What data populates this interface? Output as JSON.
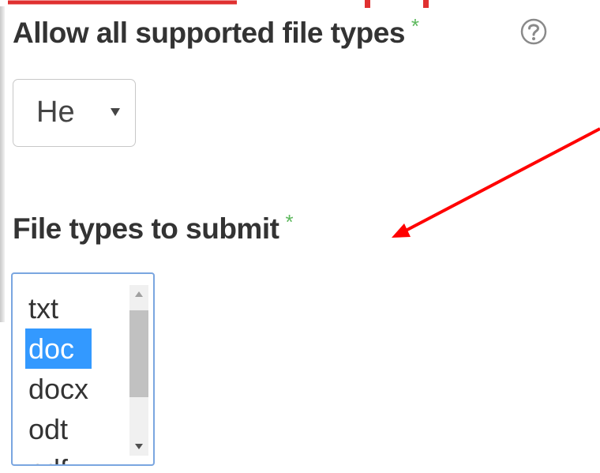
{
  "allow_types": {
    "label": "Allow all supported file types",
    "required_marker": "*",
    "selected_value": "He"
  },
  "file_types": {
    "label": "File types to submit",
    "required_marker": "*",
    "options": [
      "txt",
      "doc",
      "docx",
      "odt",
      "pdf"
    ],
    "selected_option": "doc"
  },
  "colors": {
    "required": "#5cb85c",
    "selection": "#3399ff",
    "annotation": "#ff0000",
    "listbox_border": "#7aa6e0"
  },
  "icons": {
    "help": "help-icon",
    "dropdown": "chevron-down-icon",
    "annotation": "arrow-annotation"
  }
}
